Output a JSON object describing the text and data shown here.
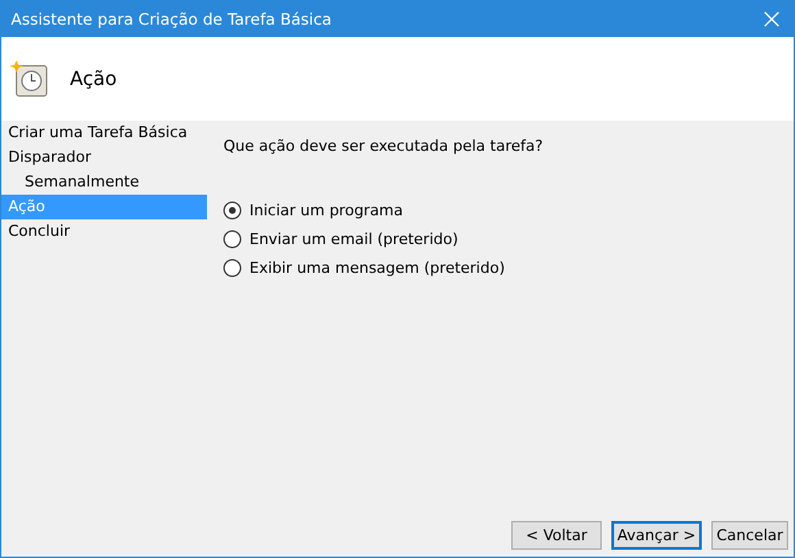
{
  "window": {
    "title": "Assistente para Criação de Tarefa Básica"
  },
  "header": {
    "title": "Ação"
  },
  "sidebar": {
    "items": [
      {
        "label": "Criar uma Tarefa Básica",
        "selected": false
      },
      {
        "label": "Disparador",
        "selected": false,
        "children": [
          {
            "label": "Semanalmente",
            "selected": false
          }
        ]
      },
      {
        "label": "Ação",
        "selected": true
      },
      {
        "label": "Concluir",
        "selected": false
      }
    ]
  },
  "question": "Que ação deve ser executada pela tarefa?",
  "options": [
    {
      "label": "Iniciar um programa",
      "selected": true
    },
    {
      "label": "Enviar um email (preterido)",
      "selected": false
    },
    {
      "label": "Exibir uma mensagem (preterido)",
      "selected": false
    }
  ],
  "buttons": [
    {
      "label": "< Voltar",
      "default": false
    },
    {
      "label": "Avançar >",
      "default": true
    },
    {
      "label": "Cancelar",
      "default": false
    }
  ]
}
